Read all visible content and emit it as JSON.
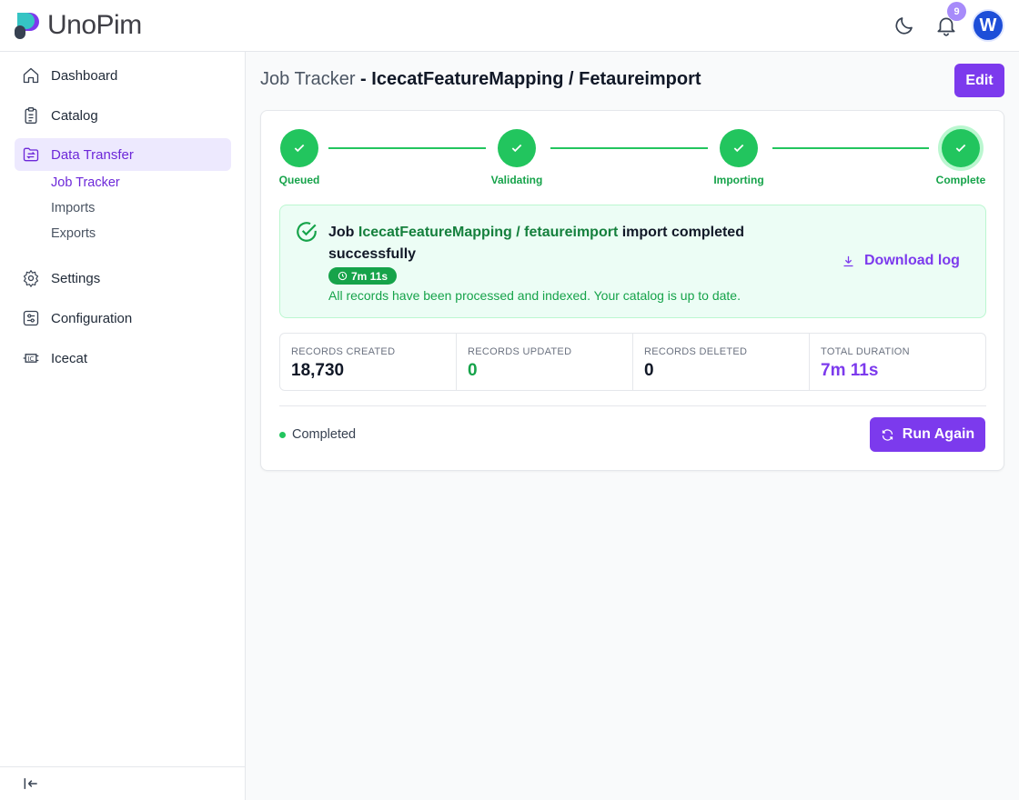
{
  "app": {
    "logo_text": "UnoPim"
  },
  "header": {
    "notification_count": "9",
    "avatar_initial": "W"
  },
  "sidebar": {
    "items": [
      {
        "label": "Dashboard",
        "icon": "home-icon"
      },
      {
        "label": "Catalog",
        "icon": "clipboard-icon"
      },
      {
        "label": "Data Transfer",
        "icon": "transfer-icon",
        "active": true
      },
      {
        "label": "Settings",
        "icon": "gear-icon"
      },
      {
        "label": "Configuration",
        "icon": "sliders-icon"
      },
      {
        "label": "Icecat",
        "icon": "icecat-icon"
      }
    ],
    "sub_items": [
      {
        "label": "Job Tracker",
        "active": true
      },
      {
        "label": "Imports"
      },
      {
        "label": "Exports"
      }
    ]
  },
  "page": {
    "title_prefix": "Job Tracker",
    "title_sep": " - ",
    "title_job": "IcecatFeatureMapping / Fetaureimport",
    "edit_label": "Edit"
  },
  "steps": [
    {
      "label": "Queued"
    },
    {
      "label": "Validating"
    },
    {
      "label": "Importing"
    },
    {
      "label": "Complete"
    }
  ],
  "alert": {
    "job_word": "Job ",
    "job_name": "IcecatFeatureMapping / fetaureimport",
    "message_tail": " import completed successfully",
    "duration": "7m 11s",
    "description": "All records have been processed and indexed. Your catalog is up to date.",
    "download_label": "Download log"
  },
  "stats": [
    {
      "label": "RECORDS CREATED",
      "value": "18,730"
    },
    {
      "label": "RECORDS UPDATED",
      "value": "0"
    },
    {
      "label": "RECORDS DELETED",
      "value": "0"
    },
    {
      "label": "TOTAL DURATION",
      "value": "7m 11s"
    }
  ],
  "footer": {
    "status_label": "Completed",
    "run_again_label": "Run Again"
  },
  "colors": {
    "accent": "#7c3aed",
    "success": "#22c55e",
    "active_bg": "#ede9fe"
  }
}
